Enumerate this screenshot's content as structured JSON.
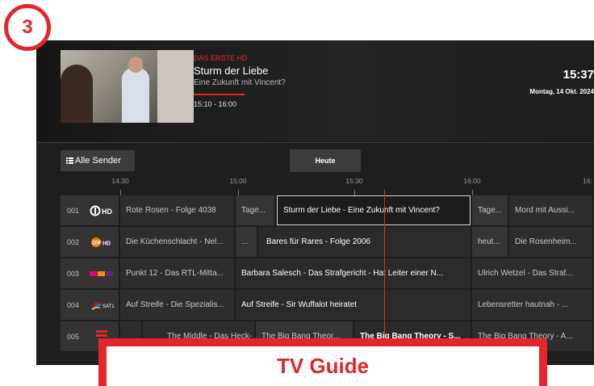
{
  "step_badge": "3",
  "header": {
    "channel_name": "DAS ERSTE HD",
    "title": "Sturm der Liebe",
    "subtitle": "Eine Zukunft mit Vincent?",
    "time_range": "15:10 - 16:00",
    "clock": "15:37",
    "date": "Montag, 14 Okt. 2024"
  },
  "controls": {
    "all_channels_label": "Alle Sender",
    "all_channels_icon": "grid-list-icon",
    "today_label": "Heute"
  },
  "timeline": {
    "ticks": [
      "14:30",
      "15:00",
      "15:30",
      "16:00",
      "16:"
    ]
  },
  "channels": [
    {
      "number": "001",
      "logo": "das-erste-logo",
      "logo_text": "HD",
      "programs": [
        "Rote Rosen - Folge 4038",
        "Tage...",
        "Sturm der Liebe - Eine Zukunft mit Vincent?",
        "Tage...",
        "Mord mit Aussi..."
      ]
    },
    {
      "number": "002",
      "logo": "zdf-logo",
      "logo_text": "ZDF HD",
      "programs": [
        "Die Küchenschlacht - Nel...",
        "...",
        "Bares für Rares - Folge 2006",
        "heut...",
        "Die Rosenheim..."
      ]
    },
    {
      "number": "003",
      "logo": "rtl-logo",
      "logo_text": "RTL",
      "programs": [
        "Punkt 12 - Das RTL-Mitta...",
        "Barbara Salesch - Das Strafgericht - Hat Leiter einer N...",
        "Ulrich Wetzel - Das Straf..."
      ]
    },
    {
      "number": "004",
      "logo": "sat1-logo",
      "logo_text": "SAT1",
      "programs": [
        "Auf Streife - Die Spezialis...",
        "Auf Streife - Sir Wuffalot heiratet",
        "Lebensretter hautnah - ..."
      ]
    },
    {
      "number": "005",
      "logo": "prosieben-logo",
      "logo_text": "",
      "programs": [
        "",
        "The Middle - Das Heck- I...",
        "The Big Bang Theor...",
        "The Big Bang Theory - S...",
        "The Big Bang Theory - A..."
      ]
    }
  ],
  "caption": "TV Guide",
  "colors": {
    "accent": "#e3262b",
    "background": "#1e1e1e",
    "cell": "#2d2d2d"
  }
}
